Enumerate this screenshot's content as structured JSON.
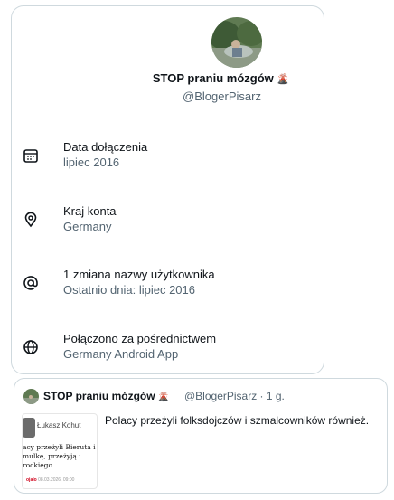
{
  "profile": {
    "display_name": "STOP praniu mózgów",
    "name_emoji": "🌋",
    "handle": "@BlogerPisarz"
  },
  "about": [
    {
      "icon": "calendar-icon",
      "label": "Data dołączenia",
      "value": "lipiec 2016"
    },
    {
      "icon": "location-pin-icon",
      "label": "Kraj konta",
      "value": "Germany"
    },
    {
      "icon": "at-sign-icon",
      "label": "1 zmiana nazwy użytkownika",
      "value": "Ostatnio dnia: lipiec 2016"
    },
    {
      "icon": "globe-icon",
      "label": "Połączono za pośrednictwem",
      "value": "Germany Android App"
    }
  ],
  "tweet": {
    "display_name": "STOP praniu mózgów",
    "name_emoji": "🌋",
    "meta": "@BlogerPisarz · 1 g.",
    "text": "Polacy przeżyli folksdojczów i szmalcowników również.",
    "preview": {
      "author": "Łukasz Kohut",
      "headline": "acy przeżyli Bieruta i mulkę, przeżyją i rockiego",
      "footer_brand": "ojalo",
      "footer_date": "08.03.2026, 09:00"
    }
  },
  "colors": {
    "text": "#0f1419",
    "secondary": "#536471",
    "border": "#cfd9de"
  }
}
